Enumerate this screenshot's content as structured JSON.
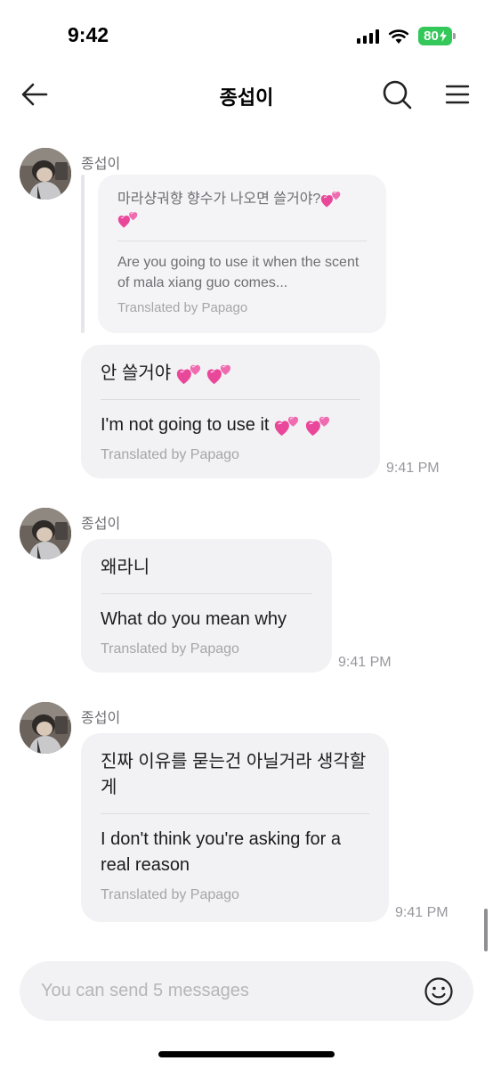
{
  "status": {
    "time": "9:42",
    "battery": "80"
  },
  "header": {
    "title": "종섭이"
  },
  "quoted": {
    "original": "마라샹궈향 향수가 나오면 쓸거야?",
    "translation": "Are you going to use it when the scent of mala xiang guo comes...",
    "credit": "Translated by Papago"
  },
  "messages": [
    {
      "sender": "종섭이",
      "original": "안 쓸거야",
      "translation": "I'm not going to use it",
      "credit": "Translated by Papago",
      "time": "9:41 PM"
    },
    {
      "sender": "종섭이",
      "original": "왜라니",
      "translation": "What do you mean why",
      "credit": "Translated by Papago",
      "time": "9:41 PM"
    },
    {
      "sender": "종섭이",
      "original": "진짜 이유를 묻는건 아닐거라 생각할게",
      "translation": "I don't think you're asking for a real reason",
      "credit": "Translated by Papago",
      "time": "9:41 PM"
    }
  ],
  "composer": {
    "placeholder": "You can send 5 messages"
  },
  "colors": {
    "bubble": "#f2f2f5",
    "battery": "#34c759",
    "heart": "#e9479a"
  }
}
